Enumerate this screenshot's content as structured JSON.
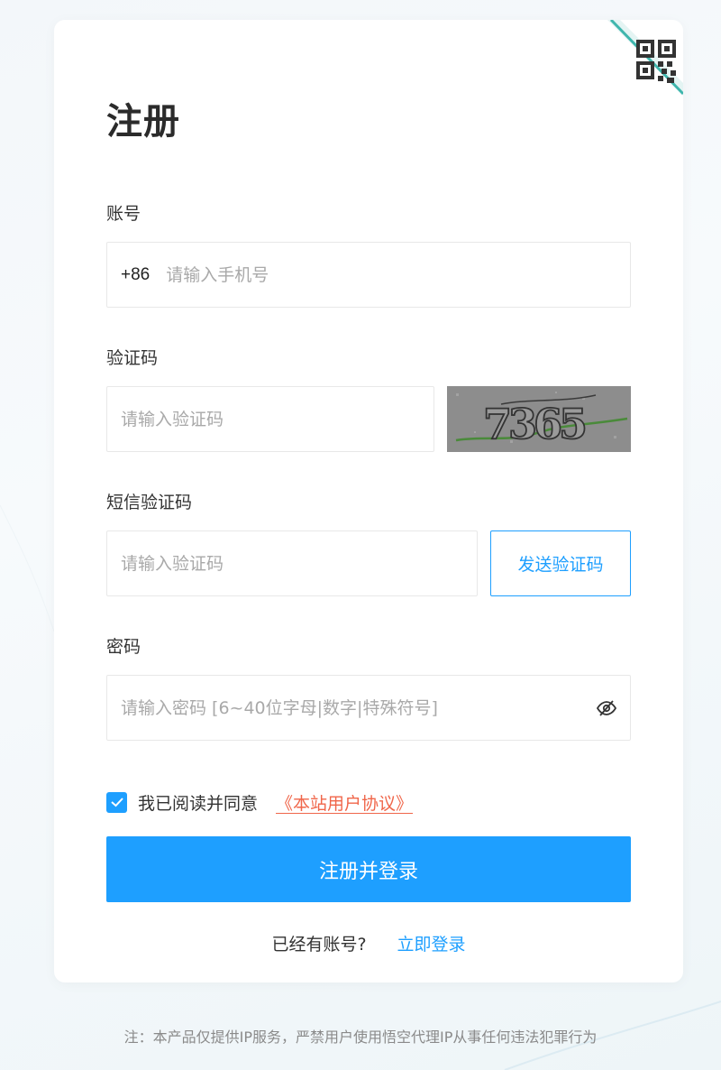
{
  "page": {
    "title": "注册"
  },
  "account": {
    "label": "账号",
    "prefix": "+86",
    "placeholder": "请输入手机号"
  },
  "captcha": {
    "label": "验证码",
    "placeholder": "请输入验证码",
    "image_text": "7365"
  },
  "sms": {
    "label": "短信验证码",
    "placeholder": "请输入验证码",
    "send_label": "发送验证码"
  },
  "password": {
    "label": "密码",
    "placeholder": "请输入密码 [6~40位字母|数字|特殊符号]"
  },
  "agreement": {
    "checked": true,
    "text": "我已阅读并同意",
    "link": "《本站用户协议》"
  },
  "submit": {
    "label": "注册并登录"
  },
  "login": {
    "question": "已经有账号?",
    "link": "立即登录"
  },
  "footer": {
    "note": "注：本产品仅提供IP服务，严禁用户使用悟空代理IP从事任何违法犯罪行为"
  },
  "colors": {
    "accent": "#1e9fff",
    "link_red": "#f0664a",
    "teal": "#2aa198"
  }
}
